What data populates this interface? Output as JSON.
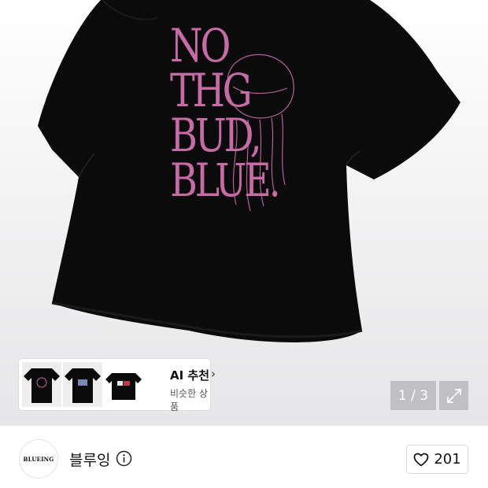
{
  "product": {
    "print_lines": "NO\nTHG\nBUD,\nBLUE.",
    "image_counter": "1 / 3"
  },
  "recommendation": {
    "title": "AI 추천",
    "chevron": "›",
    "subtitle": "비슷한 상품"
  },
  "store": {
    "logo_text": "BLUEING",
    "name": "블루잉",
    "like_count": "201"
  },
  "colors": {
    "shirt": "#0b0b0b",
    "print": "#c86aa6"
  },
  "icons": [
    "expand-icon",
    "info-icon",
    "heart-icon",
    "chevron-right-icon"
  ]
}
